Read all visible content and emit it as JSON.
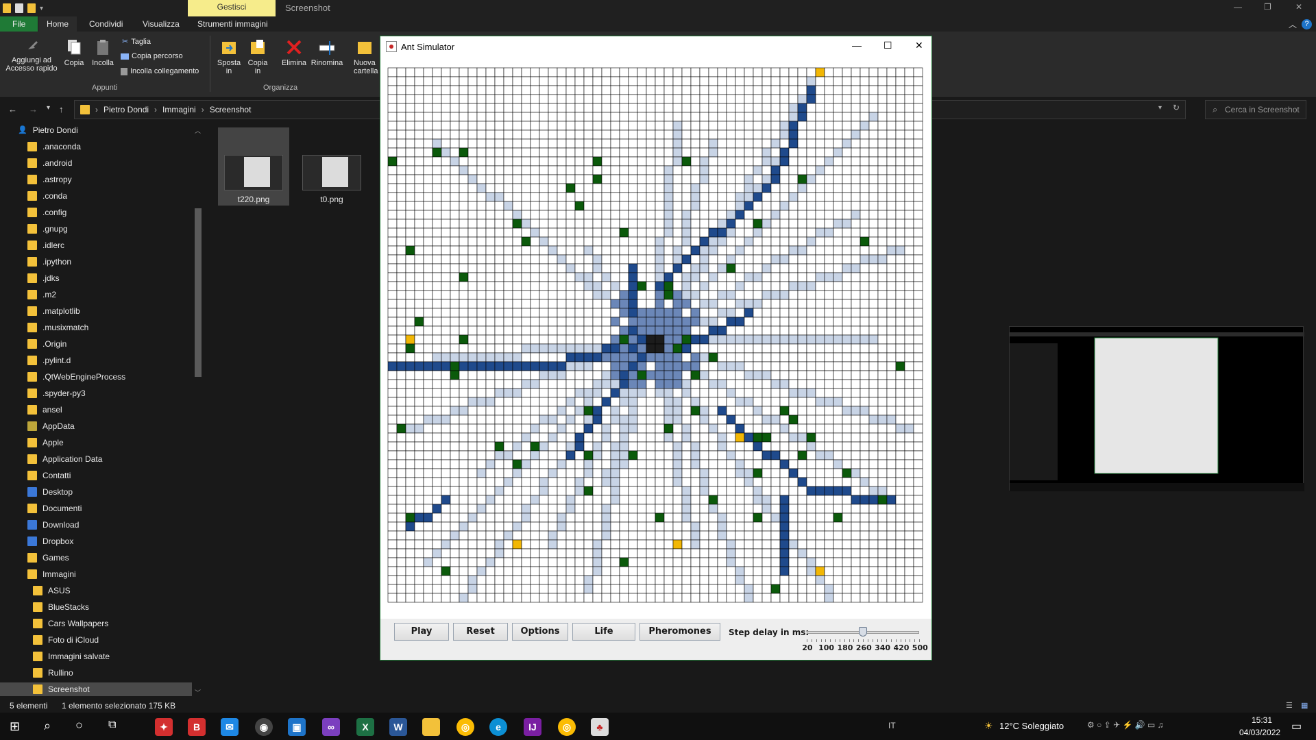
{
  "explorer": {
    "contextual_tab": "Gestisci",
    "window_title": "Screenshot",
    "tabs": [
      "File",
      "Home",
      "Condividi",
      "Visualizza",
      "Strumenti immagini"
    ],
    "ribbon": {
      "pin_label": "Aggiungi ad\nAccesso rapido",
      "copy_label": "Copia",
      "paste_label": "Incolla",
      "cut_label": "Taglia",
      "copy_path_label": "Copia percorso",
      "paste_link_label": "Incolla collegamento",
      "group_clipboard": "Appunti",
      "move_label": "Sposta\nin",
      "copyto_label": "Copia\nin",
      "delete_label": "Elimina",
      "rename_label": "Rinomina",
      "newfolder_label": "Nuova\ncartella",
      "group_organize": "Organizza"
    },
    "breadcrumb": [
      "Pietro Dondi",
      "Immagini",
      "Screenshot"
    ],
    "search_placeholder": "Cerca in Screenshot",
    "sidebar": [
      {
        "label": "Pietro Dondi",
        "level": 0,
        "icon": "user-icon"
      },
      {
        "label": ".anaconda",
        "level": 1
      },
      {
        "label": ".android",
        "level": 1
      },
      {
        "label": ".astropy",
        "level": 1
      },
      {
        "label": ".conda",
        "level": 1
      },
      {
        "label": ".config",
        "level": 1
      },
      {
        "label": ".gnupg",
        "level": 1
      },
      {
        "label": ".idlerc",
        "level": 1
      },
      {
        "label": ".ipython",
        "level": 1
      },
      {
        "label": ".jdks",
        "level": 1
      },
      {
        "label": ".m2",
        "level": 1
      },
      {
        "label": ".matplotlib",
        "level": 1
      },
      {
        "label": ".musixmatch",
        "level": 1
      },
      {
        "label": ".Origin",
        "level": 1
      },
      {
        "label": ".pylint.d",
        "level": 1
      },
      {
        "label": ".QtWebEngineProcess",
        "level": 1
      },
      {
        "label": ".spyder-py3",
        "level": 1
      },
      {
        "label": "ansel",
        "level": 1
      },
      {
        "label": "AppData",
        "level": 1,
        "icon": "olive"
      },
      {
        "label": "Apple",
        "level": 1
      },
      {
        "label": "Application Data",
        "level": 1
      },
      {
        "label": "Contatti",
        "level": 1
      },
      {
        "label": "Desktop",
        "level": 1,
        "icon": "special"
      },
      {
        "label": "Documenti",
        "level": 1
      },
      {
        "label": "Download",
        "level": 1,
        "icon": "special"
      },
      {
        "label": "Dropbox",
        "level": 1,
        "icon": "special"
      },
      {
        "label": "Games",
        "level": 1
      },
      {
        "label": "Immagini",
        "level": 1
      },
      {
        "label": "ASUS",
        "level": 2
      },
      {
        "label": "BlueStacks",
        "level": 2
      },
      {
        "label": "Cars Wallpapers",
        "level": 2
      },
      {
        "label": "Foto di iCloud",
        "level": 2
      },
      {
        "label": "Immagini salvate",
        "level": 2
      },
      {
        "label": "Rullino",
        "level": 2
      },
      {
        "label": "Screenshot",
        "level": 2,
        "selected": true
      }
    ],
    "files": [
      {
        "name": "t220.png",
        "selected": true
      },
      {
        "name": "t0.png",
        "selected": false
      }
    ],
    "status": {
      "count": "5 elementi",
      "selection": "1 elemento selezionato  175 KB"
    }
  },
  "ant_window": {
    "title": "Ant Simulator",
    "buttons": {
      "play": "Play",
      "reset": "Reset",
      "options": "Options",
      "life": "Life",
      "pheromones": "Pheromones"
    },
    "delay_label": "Step delay in ms:",
    "slider": {
      "min": 20,
      "max": 500,
      "value": 260,
      "tick_labels": [
        "20",
        "100",
        "180",
        "260",
        "340",
        "420",
        "500"
      ]
    },
    "grid": {
      "cols": 60,
      "rows": 60,
      "colors": {
        "empty": "#ffffff",
        "line": "#000000",
        "pher_light": "#c8d4e6",
        "pher_mid": "#6b87b8",
        "pher_dark": "#1f4a8c",
        "food": "#0b5a0b",
        "nest": "#1c1c1c",
        "ant": "#f2b705"
      }
    }
  },
  "taskbar": {
    "weather": "12°C  Soleggiato",
    "lang": "IT",
    "time": "15:31",
    "date": "04/03/2022"
  }
}
